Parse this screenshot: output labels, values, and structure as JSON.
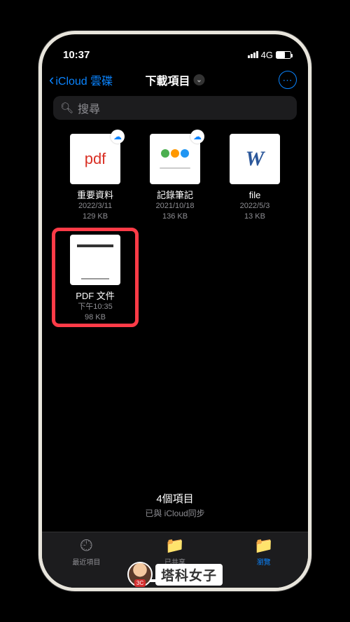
{
  "status": {
    "time": "10:37",
    "network": "4G"
  },
  "nav": {
    "back_label": "iCloud 雲碟",
    "title": "下載項目"
  },
  "search": {
    "placeholder": "搜尋"
  },
  "files": [
    {
      "name": "重要資料",
      "date": "2022/3/11",
      "size": "129 KB",
      "type": "pdf",
      "cloud": true
    },
    {
      "name": "記錄筆記",
      "date": "2021/10/18",
      "size": "136 KB",
      "type": "doc",
      "cloud": true
    },
    {
      "name": "file",
      "date": "2022/5/3",
      "size": "13 KB",
      "type": "word",
      "cloud": false
    },
    {
      "name": "PDF 文件",
      "date": "下午10:35",
      "size": "98 KB",
      "type": "article",
      "cloud": false,
      "highlighted": true
    }
  ],
  "footer": {
    "count": "4個項目",
    "sync": "已與 iCloud同步"
  },
  "tabs": {
    "recent": "最近項目",
    "shared": "已共享",
    "browse": "瀏覽"
  },
  "watermark": {
    "badge": "3C",
    "text": "塔科女子"
  }
}
